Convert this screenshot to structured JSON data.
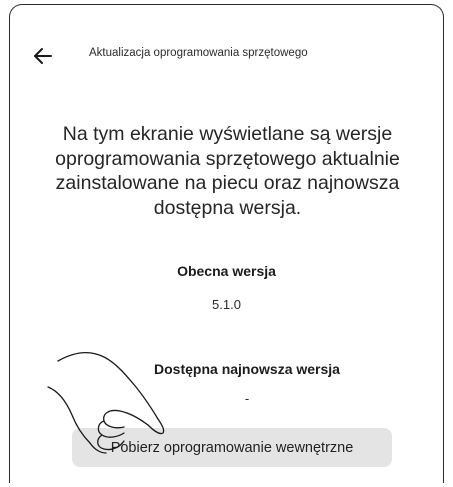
{
  "header": {
    "back_icon": "arrow-left-icon",
    "title": "Aktualizacja oprogramowania sprzętowego"
  },
  "main": {
    "description": "Na tym ekranie wyświetlane są wersje oprogramowania sprzętowego aktualnie zainstalowane na piecu oraz najnowsza dostępna wersja.",
    "current_version_label": "Obecna wersja",
    "current_version_value": "5.1.0",
    "latest_version_label": "Dostępna najnowsza wersja",
    "latest_version_value": "-",
    "download_button_label": "Pobierz oprogramowanie wewnętrzne"
  },
  "illustration": {
    "hand_icon": "pointing-hand-icon"
  }
}
